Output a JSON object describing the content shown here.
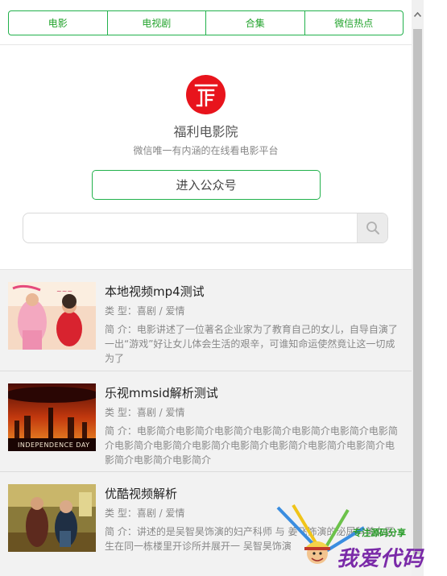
{
  "tabs": [
    "电影",
    "电视剧",
    "合集",
    "微信热点"
  ],
  "header": {
    "logo_icon": "fuli-logo-icon",
    "name": "福利电影院",
    "slogan": "微信唯一有内涵的在线看电影平台",
    "follow_button": "进入公众号"
  },
  "search": {
    "placeholder": "",
    "icon": "search-icon"
  },
  "movies": [
    {
      "title": "本地视频mp4测试",
      "meta": "类 型：喜剧 / 爱情",
      "desc": "简 介：电影讲述了一位著名企业家为了教育自己的女儿，自导自演了一出“游戏”好让女儿体会生活的艰辛，可谁知命运使然竟让这一切成为了"
    },
    {
      "title": "乐视mmsid解析测试",
      "meta": "类 型：喜剧 / 爱情",
      "desc": "简 介：电影简介电影简介电影简介电影简介电影简介电影简介电影简介电影简介电影简介电影简介电影简介电影简介电影简介电影简介电影简介电影简介电影简介"
    },
    {
      "title": "优酷视频解析",
      "meta": "类 型：喜剧 / 爱情",
      "desc": "简 介：讲述的是吴智昊饰演的妇产科师 与 姜飞饰演的泌尿科美女医生在同一栋楼里开诊所并展开一 吴智昊饰演"
    }
  ],
  "watermark": {
    "tagline": "专注源码分享",
    "brand": "我爱代码"
  },
  "colors": {
    "accent": "#22b14c",
    "logo": "#e8141c",
    "list_bg": "#f2f2f2"
  }
}
